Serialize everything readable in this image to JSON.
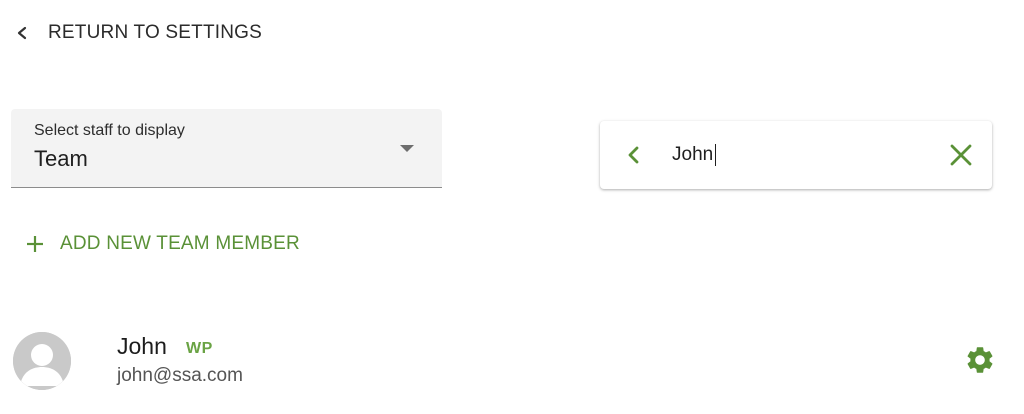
{
  "nav": {
    "return_label": "RETURN TO SETTINGS",
    "return_icon": "chevron-left-icon"
  },
  "staff_select": {
    "label": "Select staff to display",
    "value": "Team",
    "icon": "dropdown-caret-icon"
  },
  "search": {
    "value": "John",
    "back_icon": "chevron-left-icon",
    "clear_icon": "close-icon"
  },
  "add_member": {
    "label": "ADD NEW TEAM MEMBER",
    "icon": "plus-icon"
  },
  "staff": [
    {
      "name": "John",
      "badge": "WP",
      "email": "john@ssa.com",
      "avatar_icon": "person-avatar-icon",
      "settings_icon": "gear-icon"
    }
  ],
  "colors": {
    "accent": "#5a9137",
    "badge": "#6aa344",
    "field_bg": "#f3f3f3",
    "avatar_bg": "#c9c9c9"
  }
}
